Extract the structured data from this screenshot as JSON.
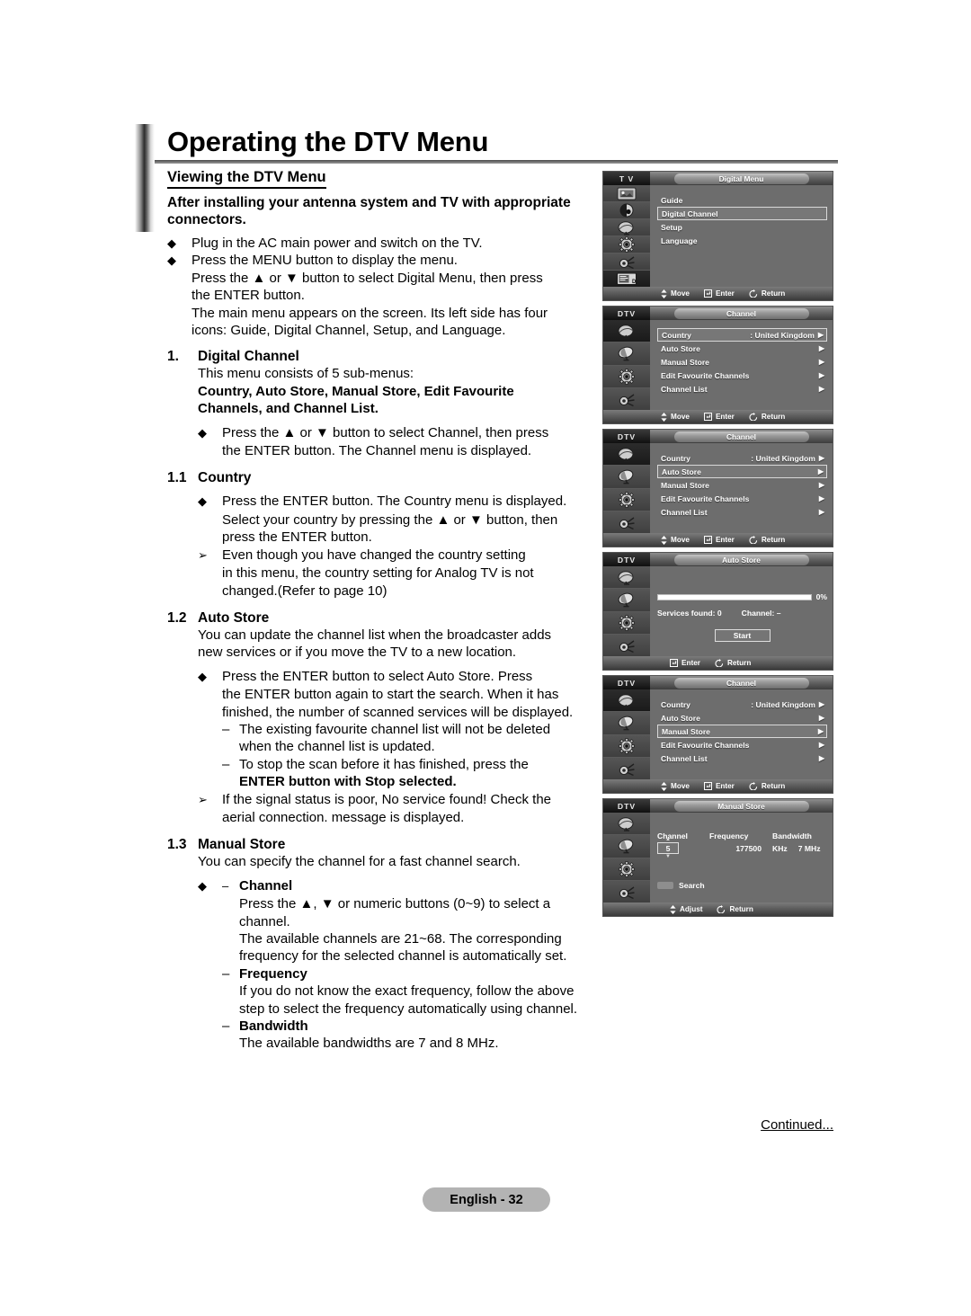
{
  "document": {
    "title": "Operating the DTV Menu",
    "section_heading": "Viewing the DTV Menu",
    "lead": "After installing your antenna system and TV with appropriate connectors.",
    "continued": "Continued...",
    "page_badge": "English - 32"
  },
  "intro_bullets": [
    {
      "marker": "◆",
      "text": "Plug in the AC main power and switch on the TV."
    },
    {
      "marker": "◆",
      "text": "Press the MENU button to display the menu."
    }
  ],
  "intro_cont": [
    "Press the ▲ or ▼ button to select Digital Menu, then press",
    "the ENTER button.",
    "The main menu appears on the screen. Its left side has four",
    "icons: Guide, Digital Channel, Setup, and Language."
  ],
  "sections": {
    "s1": {
      "number": "1.",
      "title": "Digital Channel",
      "body_line1": "This menu consists of 5 sub-menus:",
      "body_line2": "Country, Auto Store, Manual Store, Edit Favourite",
      "body_line3": "Channels, and Channel List.",
      "bullet_marker": "◆",
      "bullet_l1": "Press the ▲ or ▼ button to select Channel, then press",
      "bullet_l2": "the ENTER button. The Channel menu is displayed."
    },
    "s11": {
      "number": "1.1",
      "title": "Country",
      "bullet_marker": "◆",
      "b_l1": "Press the ENTER button. The Country menu is displayed.",
      "b_l2": "Select your country by pressing the ▲ or ▼ button, then",
      "b_l3": "press the ENTER button.",
      "note_marker": "➢",
      "n_l1": "Even though you have changed the country setting",
      "n_l2": "in this menu, the country setting for Analog TV is not",
      "n_l3": "changed.(Refer to page 10)"
    },
    "s12": {
      "number": "1.2",
      "title": "Auto Store",
      "body_l1": "You can update the channel list when the broadcaster adds",
      "body_l2": "new services or if you move the TV to a new location.",
      "bullet_marker": "◆",
      "b_l1": "Press the ENTER button to select Auto Store. Press",
      "b_l2": "the ENTER button again to start the search. When it has",
      "b_l3": "finished, the number of scanned services will be displayed.",
      "dash": "–",
      "d1_l1": "The existing favourite channel list will not be deleted",
      "d1_l2": "when the channel list is updated.",
      "d2_l1": "To stop the scan before it has finished, press the",
      "d2_l2": "ENTER button with Stop selected.",
      "note_marker": "➢",
      "n_l1": "If the signal status is poor, No service found! Check the",
      "n_l2": "aerial connection. message is displayed."
    },
    "s13": {
      "number": "1.3",
      "title": "Manual Store",
      "body": "You can specify the channel for a fast channel search.",
      "bullet_marker": "◆",
      "dash": "–",
      "ch_title": "Channel",
      "ch_l1": "Press the ▲, ▼ or numeric buttons (0~9) to select a",
      "ch_l2": "channel.",
      "ch_l3": "The available channels are 21~68. The corresponding",
      "ch_l4": "frequency for the selected channel is automatically set.",
      "fr_title": "Frequency",
      "fr_l1": "If you do not know the exact frequency, follow the above",
      "fr_l2": "step to select the frequency automatically using channel.",
      "bw_title": "Bandwidth",
      "bw_l1": "The available bandwidths are 7 and 8 MHz."
    }
  },
  "footer_hints": {
    "move": "Move",
    "enter": "Enter",
    "return": "Return",
    "adjust": "Adjust"
  },
  "panels": [
    {
      "source": "T V",
      "title": "Digital Menu",
      "icons": [
        "picture-icon",
        "sound-icon",
        "channel-icon",
        "setup-icon",
        "input-icon",
        "dtv-icon"
      ],
      "active_icon_index": 5,
      "items": [
        {
          "label": "Guide",
          "value": "",
          "arrow": "",
          "selected": false
        },
        {
          "label": "Digital Channel",
          "value": "",
          "arrow": "",
          "selected": true
        },
        {
          "label": "Setup",
          "value": "",
          "arrow": "",
          "selected": false
        },
        {
          "label": "Language",
          "value": "",
          "arrow": "",
          "selected": false
        }
      ],
      "footer": [
        "Move",
        "Enter",
        "Return"
      ]
    },
    {
      "source": "DTV",
      "title": "Channel",
      "icons": [
        "channel-icon",
        "satellite-icon",
        "setup-icon",
        "input-icon"
      ],
      "active_icon_index": 0,
      "items": [
        {
          "label": "Country",
          "value": ": United Kingdom",
          "arrow": "▶",
          "selected": true
        },
        {
          "label": "Auto Store",
          "value": "",
          "arrow": "▶",
          "selected": false
        },
        {
          "label": "Manual Store",
          "value": "",
          "arrow": "▶",
          "selected": false
        },
        {
          "label": "Edit Favourite Channels",
          "value": "",
          "arrow": "▶",
          "selected": false
        },
        {
          "label": "Channel List",
          "value": "",
          "arrow": "▶",
          "selected": false
        }
      ],
      "footer": [
        "Move",
        "Enter",
        "Return"
      ]
    },
    {
      "source": "DTV",
      "title": "Channel",
      "icons": [
        "channel-icon",
        "satellite-icon",
        "setup-icon",
        "input-icon"
      ],
      "active_icon_index": 0,
      "items": [
        {
          "label": "Country",
          "value": ": United Kingdom",
          "arrow": "▶",
          "selected": false
        },
        {
          "label": "Auto Store",
          "value": "",
          "arrow": "▶",
          "selected": true
        },
        {
          "label": "Manual Store",
          "value": "",
          "arrow": "▶",
          "selected": false
        },
        {
          "label": "Edit Favourite Channels",
          "value": "",
          "arrow": "▶",
          "selected": false
        },
        {
          "label": "Channel List",
          "value": "",
          "arrow": "▶",
          "selected": false
        }
      ],
      "footer": [
        "Move",
        "Enter",
        "Return"
      ]
    },
    {
      "source": "DTV",
      "title": "Auto Store",
      "icons": [
        "channel-icon",
        "satellite-icon",
        "setup-icon",
        "input-icon"
      ],
      "active_icon_index": -1,
      "progress_percent": "0%",
      "progress_value": 0,
      "services_found": "Services found: 0",
      "channel_status": "Channel: –",
      "start_label": "Start",
      "footer": [
        "Enter",
        "Return"
      ]
    },
    {
      "source": "DTV",
      "title": "Channel",
      "icons": [
        "channel-icon",
        "satellite-icon",
        "setup-icon",
        "input-icon"
      ],
      "active_icon_index": 0,
      "items": [
        {
          "label": "Country",
          "value": ": United Kingdom",
          "arrow": "▶",
          "selected": false
        },
        {
          "label": "Auto Store",
          "value": "",
          "arrow": "▶",
          "selected": false
        },
        {
          "label": "Manual Store",
          "value": "",
          "arrow": "▶",
          "selected": true
        },
        {
          "label": "Edit Favourite Channels",
          "value": "",
          "arrow": "▶",
          "selected": false
        },
        {
          "label": "Channel List",
          "value": "",
          "arrow": "▶",
          "selected": false
        }
      ],
      "footer": [
        "Move",
        "Enter",
        "Return"
      ]
    },
    {
      "source": "DTV",
      "title": "Manual Store",
      "icons": [
        "channel-icon",
        "satellite-icon",
        "setup-icon",
        "input-icon"
      ],
      "active_icon_index": -1,
      "columns": [
        "Channel",
        "Frequency",
        "Bandwidth"
      ],
      "channel_value": "5",
      "frequency_value": "177500",
      "frequency_unit": "KHz",
      "bandwidth_value": "7 MHz",
      "search_label": "Search",
      "footer": [
        "Adjust",
        "Return"
      ]
    }
  ]
}
